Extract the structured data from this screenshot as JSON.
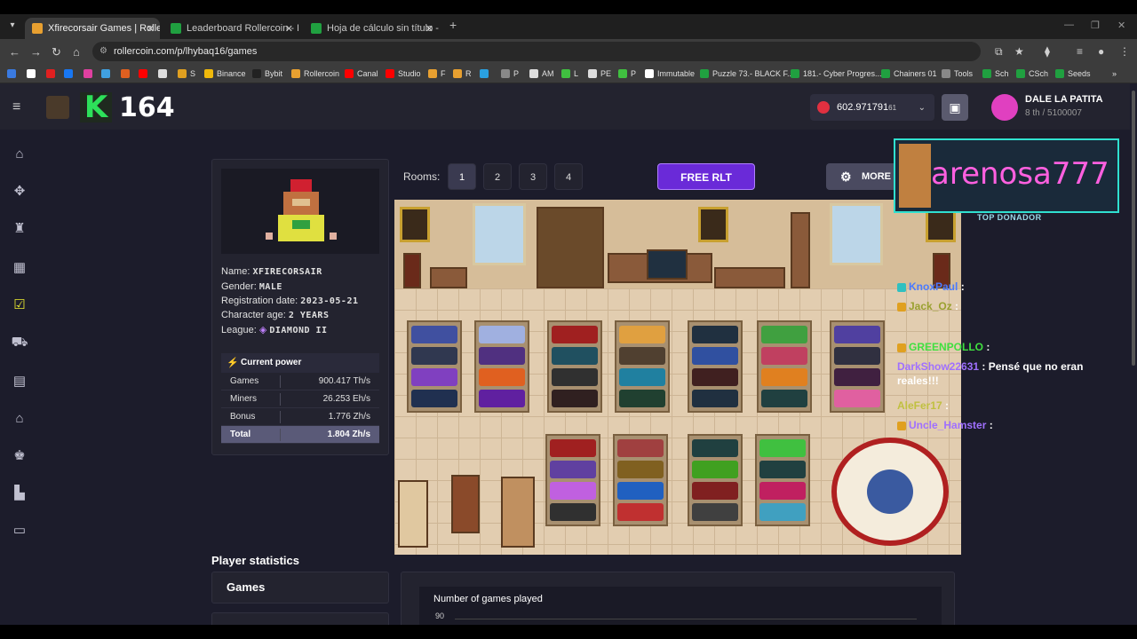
{
  "browser": {
    "tabs": [
      {
        "title": "Xfirecorsair Games | Rollercoin",
        "active": true
      },
      {
        "title": "Leaderboard Rollercoin - Hoja de",
        "active": false
      },
      {
        "title": "Hoja de cálculo sin título - Hoja",
        "active": false
      }
    ],
    "url": "rollercoin.com/p/lhybaq16/games",
    "bookmarks": [
      "S",
      "Binance",
      "Bybit",
      "Rollercoin",
      "Canal",
      "Studio",
      "F",
      "R",
      "P",
      "AM",
      "L",
      "PE",
      "P",
      "Immutable",
      "Puzzle 73.- BLACK F...",
      "181.- Cyber Progres...",
      "Chainers 01",
      "Tools",
      "Sch",
      "CSch",
      "Seeds"
    ]
  },
  "header": {
    "level_badge": "K",
    "level_number": "164",
    "balance_main": "602.971791",
    "balance_sub": "61",
    "profile_name": "DALE LA PATITA",
    "profile_rank": "8 th / 5100007"
  },
  "profile": {
    "name_label": "Name:",
    "name_value": "XFIRECORSAIR",
    "gender_label": "Gender:",
    "gender_value": "MALE",
    "reg_label": "Registration date:",
    "reg_value": "2023-05-21",
    "age_label": "Character age:",
    "age_value": "2 YEARS",
    "league_label": "League:",
    "league_value": "DIAMOND II",
    "power_title": "Current power",
    "power_rows": [
      {
        "k": "Games",
        "v": "900.417 Th/s"
      },
      {
        "k": "Miners",
        "v": "26.253 Eh/s"
      },
      {
        "k": "Bonus",
        "v": "1.776 Zh/s"
      },
      {
        "k": "Total",
        "v": "1.804 Zh/s"
      }
    ]
  },
  "rooms": {
    "label": "Rooms:",
    "buttons": [
      "1",
      "2",
      "3",
      "4"
    ],
    "active": "1",
    "free_rlt": "FREE RLT",
    "more": "MORE"
  },
  "overlay": {
    "streamer": "arenosa777",
    "top_donor": "TOP DONADOR",
    "chat": [
      {
        "user": "KnoxPaul",
        "msg": ":",
        "color": "#4a7aff"
      },
      {
        "user": "Jack_Oz",
        "msg": ":",
        "color": "#9aa030"
      },
      {
        "user": "GREENPOLLO",
        "msg": ":",
        "color": "#40e040"
      },
      {
        "user": "DarkShow22631",
        "msg": ": Pensé que no eran",
        "color": "#a070ff"
      },
      {
        "user": "",
        "msg": "reales!!!",
        "color": "#ffffff"
      },
      {
        "user": "AleFer17",
        "msg": ":",
        "color": "#c0c040"
      },
      {
        "user": "Uncle_Hamster",
        "msg": ":",
        "color": "#a070ff"
      }
    ]
  },
  "stats": {
    "title": "Player statistics",
    "games_tab": "Games",
    "chart_title": "Number of games played",
    "chart_tick": "90"
  },
  "colors": {
    "accent_green": "#2de05a",
    "accent_purple": "#6a2ad8",
    "page_bg": "#1c1c2b",
    "panel_bg": "#23232f"
  }
}
